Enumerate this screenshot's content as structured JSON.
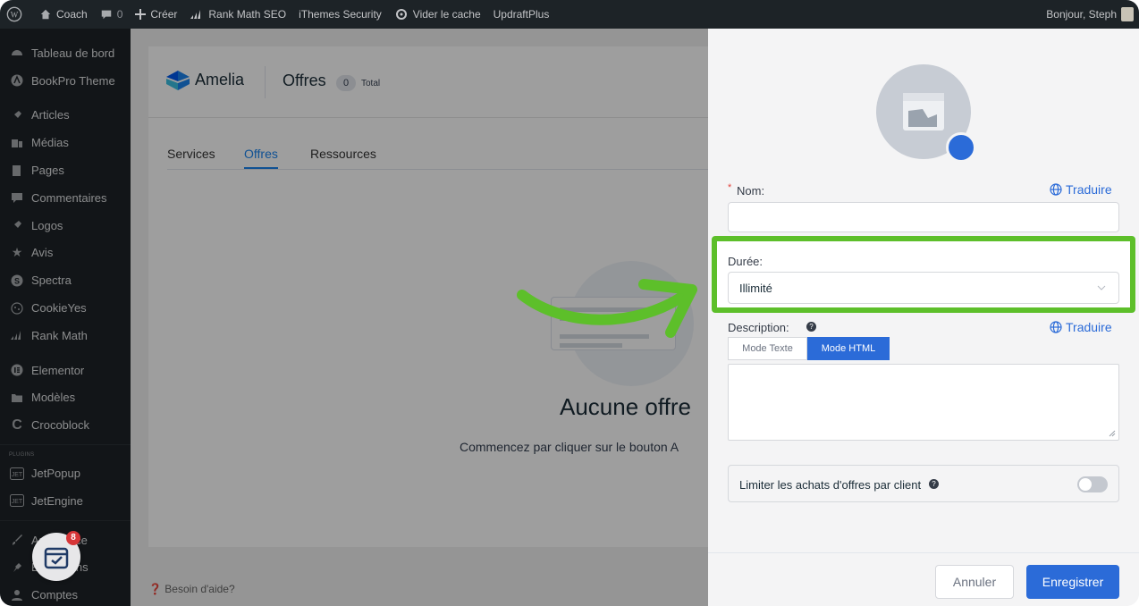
{
  "adminbar": {
    "site_name": "Coach",
    "comments_count": "0",
    "create_label": "Créer",
    "rankmath_label": "Rank Math SEO",
    "security_label": "iThemes Security",
    "cache_label": "Vider le cache",
    "updraft_label": "UpdraftPlus",
    "greeting": "Bonjour, Steph"
  },
  "sidebar": {
    "items": [
      {
        "label": "Tableau de bord",
        "icon": "dashboard-icon"
      },
      {
        "label": "BookPro Theme",
        "icon": "theme-icon"
      },
      {
        "label": "Articles",
        "icon": "pin-icon"
      },
      {
        "label": "Médias",
        "icon": "media-icon"
      },
      {
        "label": "Pages",
        "icon": "pages-icon"
      },
      {
        "label": "Commentaires",
        "icon": "comment-icon"
      },
      {
        "label": "Logos",
        "icon": "pin-icon"
      },
      {
        "label": "Avis",
        "icon": "star-icon"
      },
      {
        "label": "Spectra",
        "icon": "spectra-icon"
      },
      {
        "label": "CookieYes",
        "icon": "cookie-icon"
      },
      {
        "label": "Rank Math",
        "icon": "rankmath-icon"
      },
      {
        "label": "Elementor",
        "icon": "elementor-icon"
      },
      {
        "label": "Modèles",
        "icon": "folder-icon"
      },
      {
        "label": "Crocoblock",
        "icon": "crocoblock-icon"
      },
      {
        "label": "JetPopup",
        "icon": "jet-icon"
      },
      {
        "label": "JetEngine",
        "icon": "jet-icon"
      },
      {
        "label": "Apparence",
        "icon": "brush-icon"
      },
      {
        "label": "Extensions",
        "icon": "plugin-icon"
      },
      {
        "label": "Comptes",
        "icon": "user-icon"
      }
    ],
    "plugins_section": "PLUGINS",
    "notification_badge": "8"
  },
  "amelia": {
    "brand": "Amelia",
    "page_title": "Offres",
    "count": "0",
    "count_label": "Total",
    "tabs": [
      "Services",
      "Offres",
      "Ressources"
    ],
    "empty_title": "Aucune offre",
    "empty_text": "Commencez par cliquer sur le bouton A",
    "help": "Besoin d'aide?"
  },
  "drawer": {
    "name_label": "Nom:",
    "required_mark": "*",
    "translate_label": "Traduire",
    "duration_label": "Durée:",
    "duration_value": "Illimité",
    "description_label": "Description:",
    "mode_text": "Mode Texte",
    "mode_html": "Mode HTML",
    "limit_label": "Limiter les achats d'offres par client",
    "cancel_label": "Annuler",
    "save_label": "Enregistrer"
  },
  "colors": {
    "highlight": "#5dbf2a",
    "accent": "#2b6bd8",
    "admin_bg": "#1d2327"
  }
}
